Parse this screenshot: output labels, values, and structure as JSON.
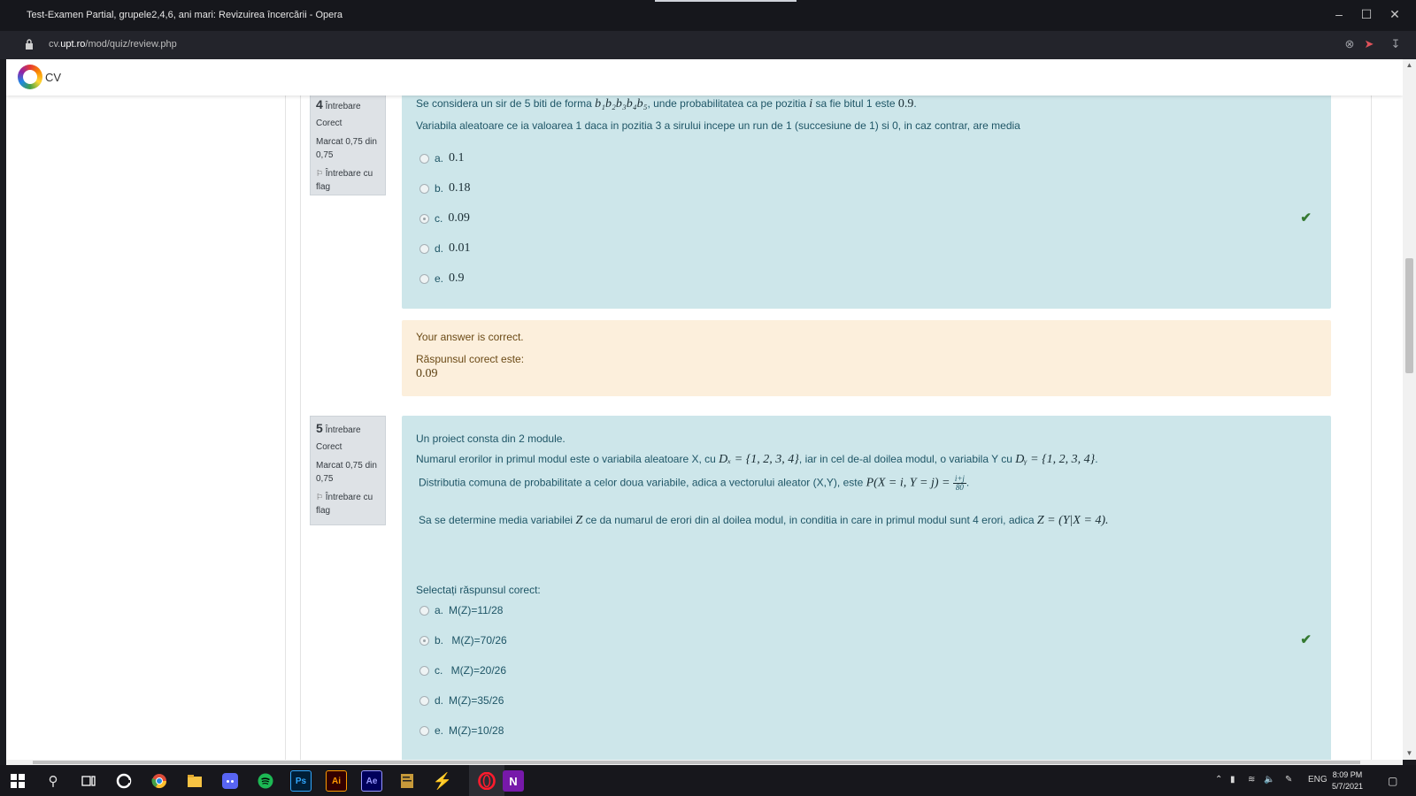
{
  "window": {
    "title": "Test-Examen Partial, grupele2,4,6, ani mari: Revizuirea încercării - Opera"
  },
  "address": {
    "url_host_prefix": "cv.",
    "url_host_domain": "upt.ro",
    "url_path": "/mod/quiz/review.php"
  },
  "site": {
    "logo_text": "CV"
  },
  "question4": {
    "number": "4",
    "label": "Întrebare",
    "state": "Corect",
    "mark": "Marcat 0,75 din 0,75",
    "flag": "Întrebare cu flag",
    "text_before": "Se considera un sir de 5 biti de forma",
    "bits": "b₁b₂b₃b₄b₅",
    "text_middle": ", unde probabilitatea ca pe pozitia",
    "var_i": "i",
    "text_after": "sa fie bitul 1 este",
    "prob": "0.9",
    "text_end": ".",
    "line2": "Variabila aleatoare ce ia valoarea 1 daca in pozitia 3 a sirului incepe un run de 1 (succesiune de 1) si 0, in caz contrar, are media",
    "options": [
      {
        "letter": "a.",
        "value": "0.1"
      },
      {
        "letter": "b.",
        "value": "0.18"
      },
      {
        "letter": "c.",
        "value": "0.09"
      },
      {
        "letter": "d.",
        "value": "0.01"
      },
      {
        "letter": "e.",
        "value": "0.9"
      }
    ],
    "feedback_correct": "Your answer is correct.",
    "feedback_label": "Răspunsul corect este:",
    "feedback_value": "0.09"
  },
  "question5": {
    "number": "5",
    "label": "Întrebare",
    "state": "Corect",
    "mark": "Marcat 0,75 din 0,75",
    "flag": "Întrebare cu flag",
    "line1": "Un proiect consta din 2 module.",
    "line2_a": "Numarul erorilor in primul modul este  o variabila aleatoare X, cu",
    "line2_dx": "Dₓ = {1, 2, 3, 4}",
    "line2_b": ", iar in cel de-al doilea modul, o variabila Y cu",
    "line2_dy": "Dᵧ = {1, 2, 3, 4}",
    "line2_c": ".",
    "line3_a": "Distributia comuna de probabilitate a celor doua variabile, adica a vectorului aleator (X,Y), este",
    "line3_p": "P(X = i, Y = j) =",
    "line3_num": "i+j",
    "line3_den": "80",
    "line3_c": ".",
    "line4_a": "Sa se determine media variabilei",
    "line4_z": "Z",
    "line4_b": "ce da numarul de erori din al doilea modul, in conditia in care in primul modul sunt 4 erori, adica",
    "line4_expr": "Z = (Y|X = 4).",
    "prompt": "Selectați răspunsul corect:",
    "options": [
      {
        "letter": "a.",
        "value": "M(Z)=11/28"
      },
      {
        "letter": "b.",
        "value": " M(Z)=70/26"
      },
      {
        "letter": "c.",
        "value": " M(Z)=20/26"
      },
      {
        "letter": "d.",
        "value": "M(Z)=35/26"
      },
      {
        "letter": "e.",
        "value": "M(Z)=10/28"
      }
    ]
  },
  "taskbar": {
    "language": "ENG",
    "time": "8:09 PM",
    "date": "5/7/2021",
    "apps": [
      "Ps",
      "Ai",
      "Ae",
      "N"
    ]
  }
}
